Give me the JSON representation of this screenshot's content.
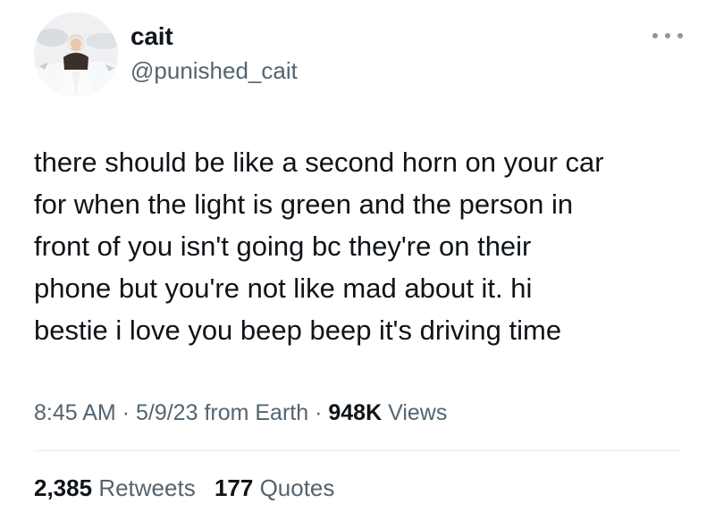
{
  "user": {
    "display_name": "cait",
    "handle": "@punished_cait"
  },
  "tweet": {
    "text": "there should be like a second horn on your car\nfor when the light is green and the person in\nfront of you isn't going bc they're on their\nphone but you're not like mad about it. hi\nbestie i love you beep beep it's driving time",
    "time": "8:45 AM",
    "date": "5/9/23",
    "source": "from Earth",
    "views_count": "948K",
    "views_label": "Views"
  },
  "stats": {
    "retweets_count": "2,385",
    "retweets_label": "Retweets",
    "quotes_count": "177",
    "quotes_label": "Quotes"
  },
  "icons": {
    "more": "more-icon"
  },
  "colors": {
    "primary_text": "#0f1419",
    "secondary_text": "#536471",
    "divider": "#e6e9ec"
  }
}
